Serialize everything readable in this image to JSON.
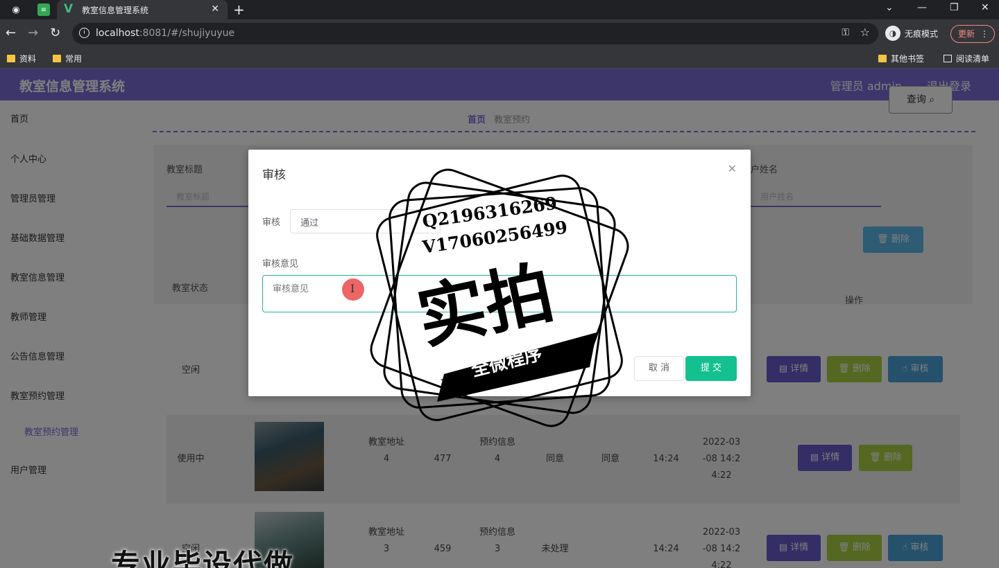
{
  "browser": {
    "tab_title": "教室信息管理系统",
    "url_host": "localhost",
    "url_rest": ":8081/#/shujiyuyue",
    "incognito_label": "无痕模式",
    "update_label": "更新",
    "bookmarks": [
      "资料",
      "常用"
    ],
    "bookmarks_right": [
      "其他书签",
      "阅读清单"
    ]
  },
  "app": {
    "title": "教室信息管理系统",
    "user": "管理员 admin",
    "logout": "退出登录"
  },
  "sidebar": {
    "items": [
      {
        "label": "首页"
      },
      {
        "label": "个人中心"
      },
      {
        "label": "管理员管理"
      },
      {
        "label": "基础数据管理"
      },
      {
        "label": "教室信息管理"
      },
      {
        "label": "教师管理"
      },
      {
        "label": "公告信息管理"
      },
      {
        "label": "教室预约管理"
      },
      {
        "label": "用户管理"
      }
    ],
    "sub_item": "教室预约管理"
  },
  "breadcrumb": {
    "home": "首页",
    "current": "教室预约"
  },
  "search": {
    "label1": "教室标题",
    "placeholder1": "教室标题",
    "label2": "户姓名",
    "placeholder2": "用户姓名",
    "query": "查询",
    "delete": "删除"
  },
  "table": {
    "status_header": "教室状态",
    "op_header": "操作",
    "rows": [
      {
        "status": "空闲"
      },
      {
        "status": "使用中",
        "addr": "教室地址\n4",
        "num": "477",
        "info": "预约信息\n4",
        "s1": "同意",
        "s2": "同意",
        "time": "14:24",
        "datetime": "2022-03\n-08 14:2\n4:22"
      },
      {
        "status": "空闲",
        "addr": "教室地址\n3",
        "num": "459",
        "info": "预约信息\n3",
        "s1": "未处理",
        "s2": "",
        "time": "14:24",
        "datetime": "2022-03\n-08 14:2\n4:22"
      }
    ],
    "op_detail": "详情",
    "op_delete": "删除",
    "op_audit": "审核"
  },
  "dialog": {
    "title": "审核",
    "select_label": "审核",
    "select_value": "通过",
    "opinion_label": "审核意见",
    "opinion_placeholder": "审核意见",
    "cancel": "取 消",
    "submit": "提 交"
  },
  "watermark": {
    "line1": "Q2196316269",
    "line2": "V17060256499",
    "big": "实拍",
    "ribbon": "全微程序",
    "bottom": "专业毕设代做"
  }
}
